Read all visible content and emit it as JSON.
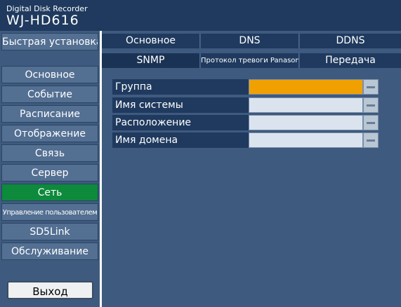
{
  "header": {
    "subtitle": "Digital Disk Recorder",
    "model": "WJ-HD616"
  },
  "sidebar": {
    "quick_setup": "Быстрая установка",
    "items": [
      {
        "label": "Основное"
      },
      {
        "label": "Событие"
      },
      {
        "label": "Расписание"
      },
      {
        "label": "Отображение"
      },
      {
        "label": "Связь"
      },
      {
        "label": "Сервер"
      },
      {
        "label": "Сеть"
      },
      {
        "label": "Управление пользователем"
      },
      {
        "label": "SD5Link"
      },
      {
        "label": "Обслуживание"
      }
    ],
    "exit": "Выход"
  },
  "tabs": {
    "row1": [
      "Основное",
      "DNS",
      "DDNS"
    ],
    "row2": [
      "SNMP",
      "Протокол тревоги Panasonic",
      "Передача"
    ]
  },
  "fields": [
    {
      "label": "Группа",
      "value": ""
    },
    {
      "label": "Имя системы",
      "value": ""
    },
    {
      "label": "Расположение",
      "value": ""
    },
    {
      "label": "Имя домена",
      "value": ""
    }
  ],
  "colors": {
    "header_bg": "#1f3a5e",
    "panel_bg": "#3e5a7e",
    "active_nav": "#0d8a3c",
    "focused_field": "#f0a000"
  }
}
